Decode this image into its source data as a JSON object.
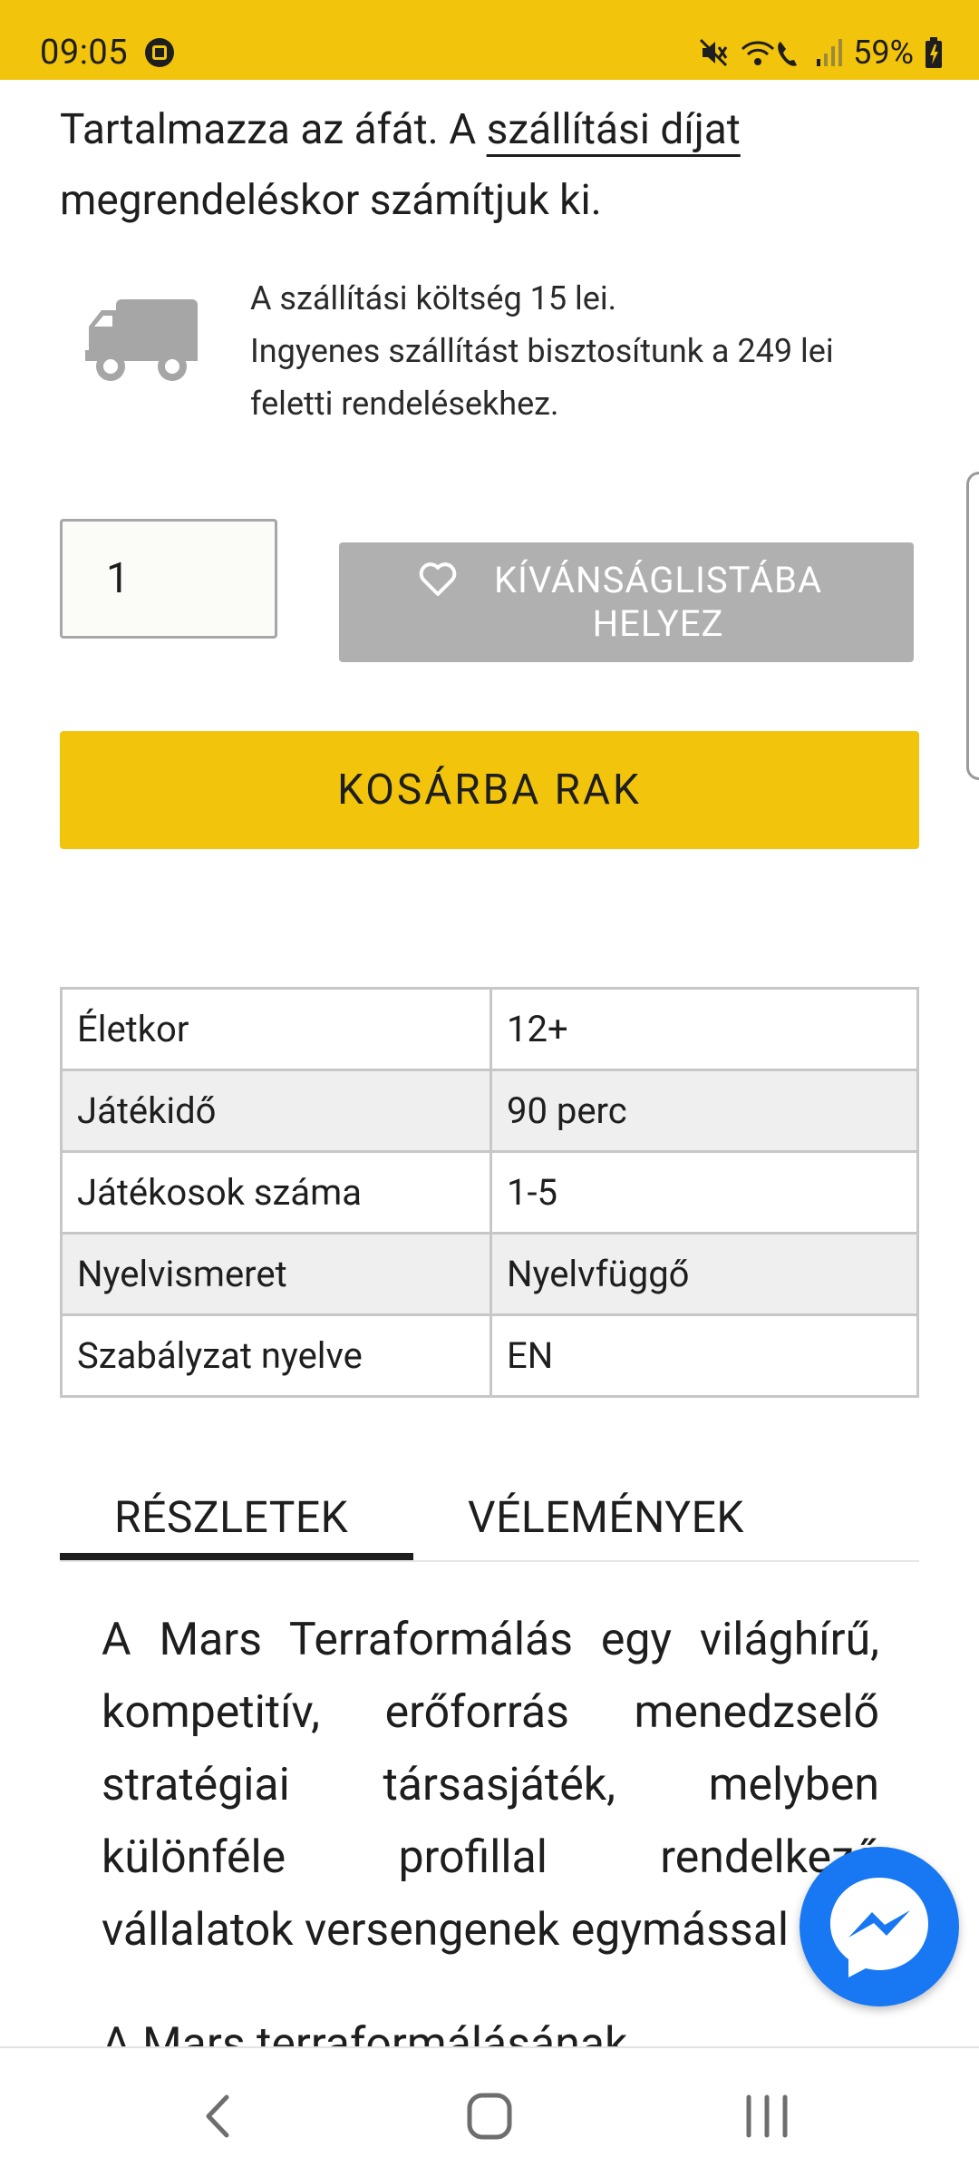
{
  "status_bar": {
    "time": "09:05",
    "battery": "59%"
  },
  "product": {
    "price_note_prefix": "Tartalmazza az áfát. A ",
    "shipping_link": "szállítási díjat",
    "price_note_suffix": " megrendeléskor számítjuk ki.",
    "shipping_line1": "A szállítási költség 15 lei.",
    "shipping_line2": "Ingyenes szállítást bisztosítunk a 249 lei feletti rendelésekhez.",
    "quantity": "1",
    "wishlist_label": "KÍVÁNSÁGLISTÁBA HELYEZ",
    "add_to_cart_label": "KOSÁRBA RAK"
  },
  "attributes": [
    {
      "label": "Életkor",
      "value": "12+"
    },
    {
      "label": "Játékidő",
      "value": "90 perc"
    },
    {
      "label": "Játékosok száma",
      "value": "1-5"
    },
    {
      "label": "Nyelvismeret",
      "value": "Nyelvfüggő"
    },
    {
      "label": "Szabályzat nyelve",
      "value": "EN"
    }
  ],
  "tabs": [
    {
      "label": "RÉSZLETEK",
      "active": true
    },
    {
      "label": "VÉLEMÉNYEK",
      "active": false
    }
  ],
  "description": {
    "paragraph1": "A Mars Terraformálás egy világhírű, kompetitív, erőforrás menedzselő stratégiai társasjáték, melyben különféle profillal rendelkező vállalatok versengenek egymással",
    "paragraph2": "A Mars terraformálásának"
  },
  "colors": {
    "accent": "#f2c40c",
    "wishlist_bg": "#b0b0b0",
    "messenger": "#1877f2"
  },
  "icons": {
    "truck": "truck-icon",
    "heart": "heart-icon",
    "messenger": "messenger-icon"
  }
}
